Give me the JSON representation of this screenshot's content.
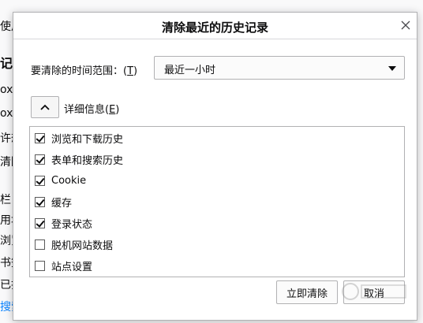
{
  "background_page": {
    "lines": [
      {
        "text": "使用"
      },
      {
        "text": "记录"
      },
      {
        "text": "ox"
      },
      {
        "text": "ox"
      },
      {
        "text": "许想"
      },
      {
        "text": "清除"
      },
      {
        "text": "栏"
      },
      {
        "text": "用址"
      },
      {
        "text": "浏览"
      },
      {
        "text": "书签"
      },
      {
        "text": "已打"
      },
      {
        "text": "搜索"
      }
    ]
  },
  "dialog": {
    "title": "清除最近的历史记录",
    "close_icon": "close-icon",
    "time_range": {
      "label": "要清除的时间范围：(",
      "access_key": "T",
      "label_end": ")",
      "selected": "最近一小时"
    },
    "details": {
      "label": "详细信息(",
      "access_key": "E",
      "label_end": ")",
      "expanded": true
    },
    "items": [
      {
        "label": "浏览和下载历史",
        "checked": true
      },
      {
        "label": "表单和搜索历史",
        "checked": true
      },
      {
        "label": "Cookie",
        "checked": true
      },
      {
        "label": "缓存",
        "checked": true
      },
      {
        "label": "登录状态",
        "checked": true
      },
      {
        "label": "脱机网站数据",
        "checked": false
      },
      {
        "label": "站点设置",
        "checked": false
      }
    ],
    "buttons": {
      "clear": "立即清除",
      "cancel": "取消"
    }
  },
  "colors": {
    "link": "#0a84ff",
    "border": "#b1b1b3",
    "text": "#0c0c0d"
  }
}
